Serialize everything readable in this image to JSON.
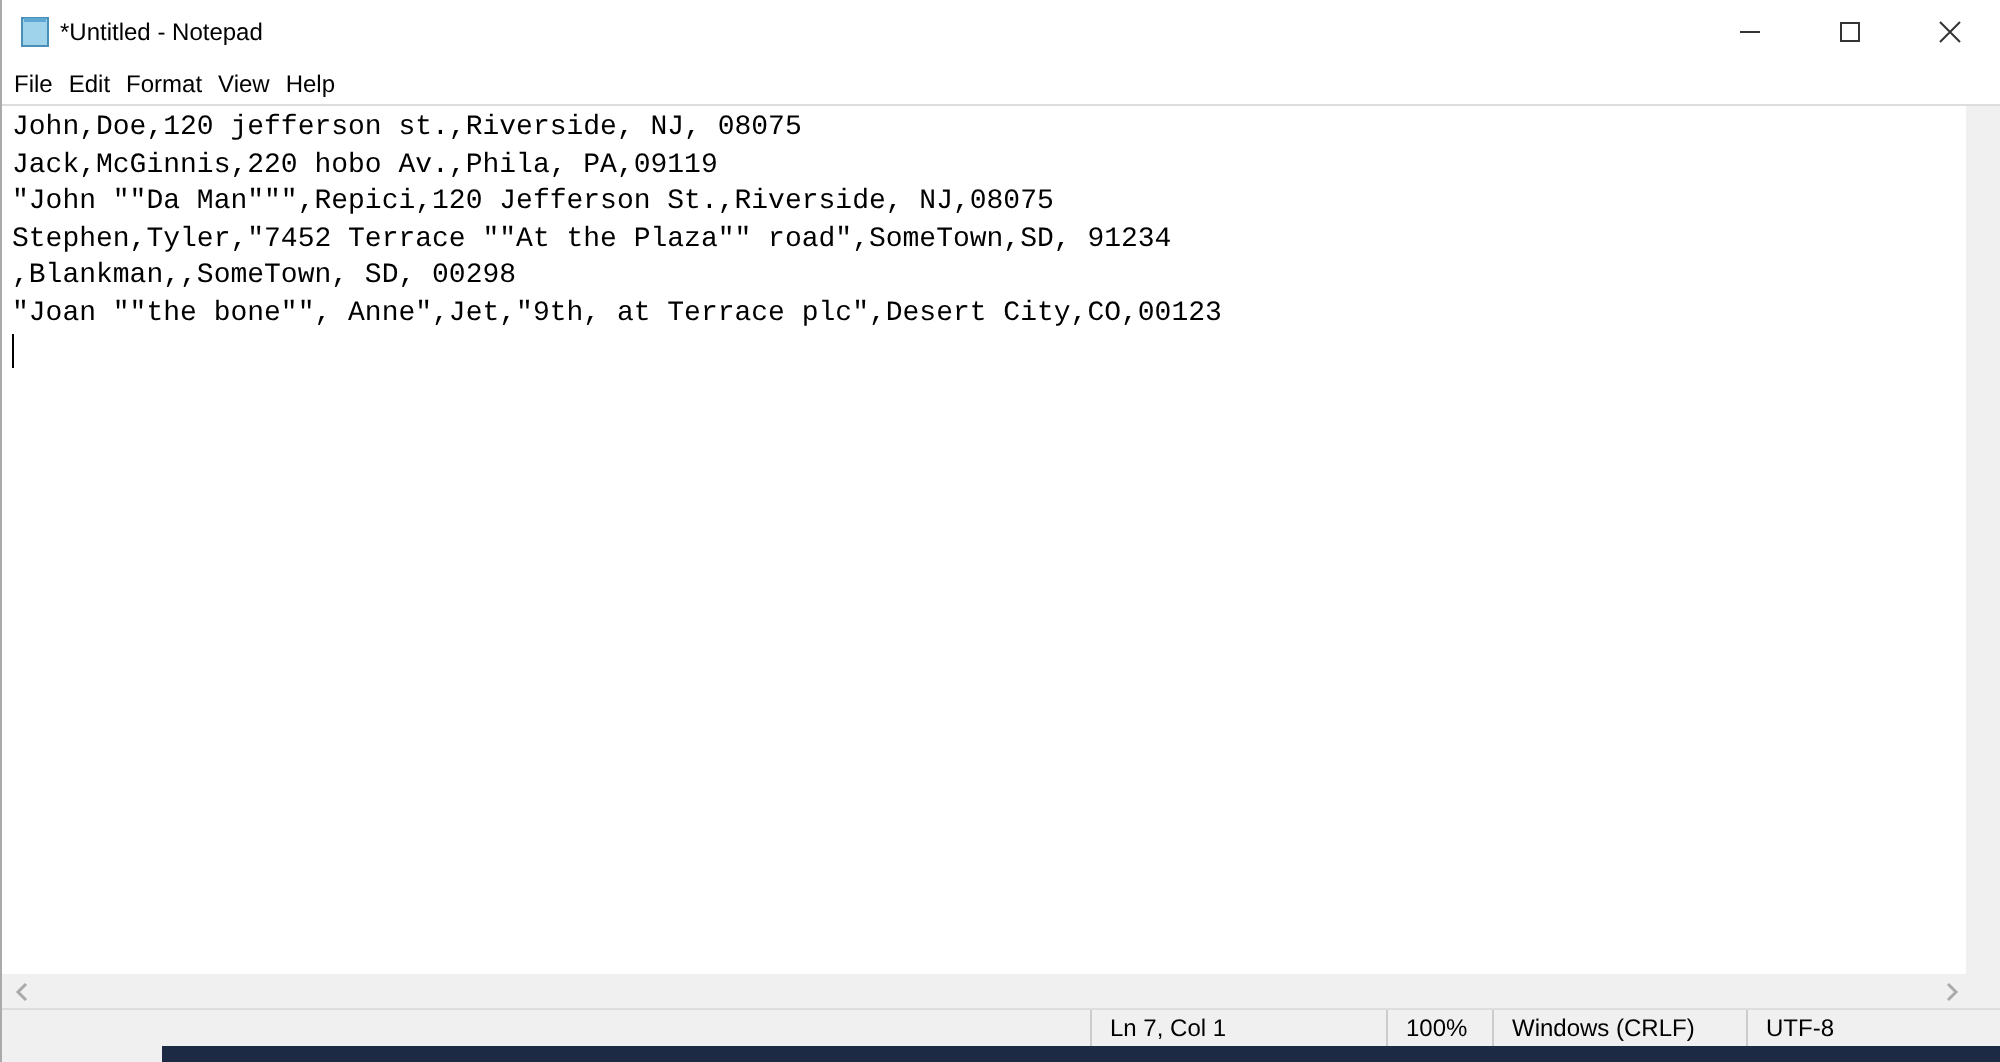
{
  "window": {
    "title": "*Untitled - Notepad"
  },
  "menu": [
    "File",
    "Edit",
    "Format",
    "View",
    "Help"
  ],
  "editor": {
    "lines": [
      "John,Doe,120 jefferson st.,Riverside, NJ, 08075",
      "Jack,McGinnis,220 hobo Av.,Phila, PA,09119",
      "\"John \"\"Da Man\"\"\",Repici,120 Jefferson St.,Riverside, NJ,08075",
      "Stephen,Tyler,\"7452 Terrace \"\"At the Plaza\"\" road\",SomeTown,SD, 91234",
      ",Blankman,,SomeTown, SD, 00298",
      "\"Joan \"\"the bone\"\", Anne\",Jet,\"9th, at Terrace plc\",Desert City,CO,00123"
    ]
  },
  "status_bar": [
    "Ln 7, Col 1",
    "100%",
    "Windows (CRLF)",
    "UTF-8"
  ]
}
